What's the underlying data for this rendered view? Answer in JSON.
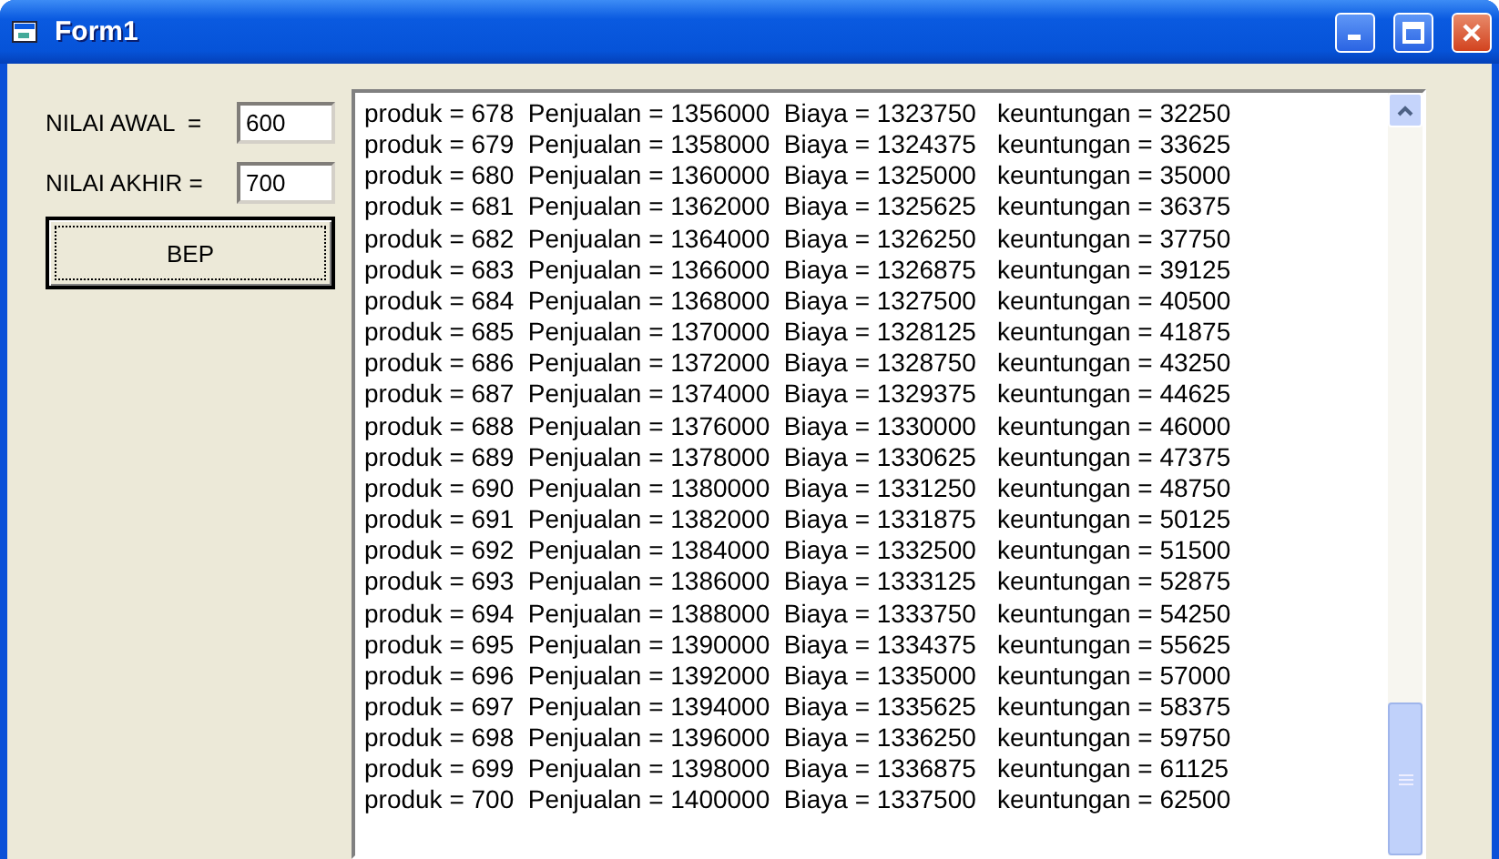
{
  "window": {
    "title": "Form1"
  },
  "fields": [
    {
      "label": "NILAI AWAL  =",
      "value": "600"
    },
    {
      "label": "NILAI AKHIR =",
      "value": "700"
    }
  ],
  "button": "BEP",
  "output_lines": [
    "produk = 678  Penjualan = 1356000  Biaya = 1323750   keuntungan = 32250",
    "produk = 679  Penjualan = 1358000  Biaya = 1324375   keuntungan = 33625",
    "produk = 680  Penjualan = 1360000  Biaya = 1325000   keuntungan = 35000",
    "produk = 681  Penjualan = 1362000  Biaya = 1325625   keuntungan = 36375",
    "produk = 682  Penjualan = 1364000  Biaya = 1326250   keuntungan = 37750",
    "produk = 683  Penjualan = 1366000  Biaya = 1326875   keuntungan = 39125",
    "produk = 684  Penjualan = 1368000  Biaya = 1327500   keuntungan = 40500",
    "produk = 685  Penjualan = 1370000  Biaya = 1328125   keuntungan = 41875",
    "produk = 686  Penjualan = 1372000  Biaya = 1328750   keuntungan = 43250",
    "produk = 687  Penjualan = 1374000  Biaya = 1329375   keuntungan = 44625",
    "produk = 688  Penjualan = 1376000  Biaya = 1330000   keuntungan = 46000",
    "produk = 689  Penjualan = 1378000  Biaya = 1330625   keuntungan = 47375",
    "produk = 690  Penjualan = 1380000  Biaya = 1331250   keuntungan = 48750",
    "produk = 691  Penjualan = 1382000  Biaya = 1331875   keuntungan = 50125",
    "produk = 692  Penjualan = 1384000  Biaya = 1332500   keuntungan = 51500",
    "produk = 693  Penjualan = 1386000  Biaya = 1333125   keuntungan = 52875",
    "produk = 694  Penjualan = 1388000  Biaya = 1333750   keuntungan = 54250",
    "produk = 695  Penjualan = 1390000  Biaya = 1334375   keuntungan = 55625",
    "produk = 696  Penjualan = 1392000  Biaya = 1335000   keuntungan = 57000",
    "produk = 697  Penjualan = 1394000  Biaya = 1335625   keuntungan = 58375",
    "produk = 698  Penjualan = 1396000  Biaya = 1336250   keuntungan = 59750",
    "produk = 699  Penjualan = 1398000  Biaya = 1336875   keuntungan = 61125",
    "produk = 700  Penjualan = 1400000  Biaya = 1337500   keuntungan = 62500"
  ]
}
